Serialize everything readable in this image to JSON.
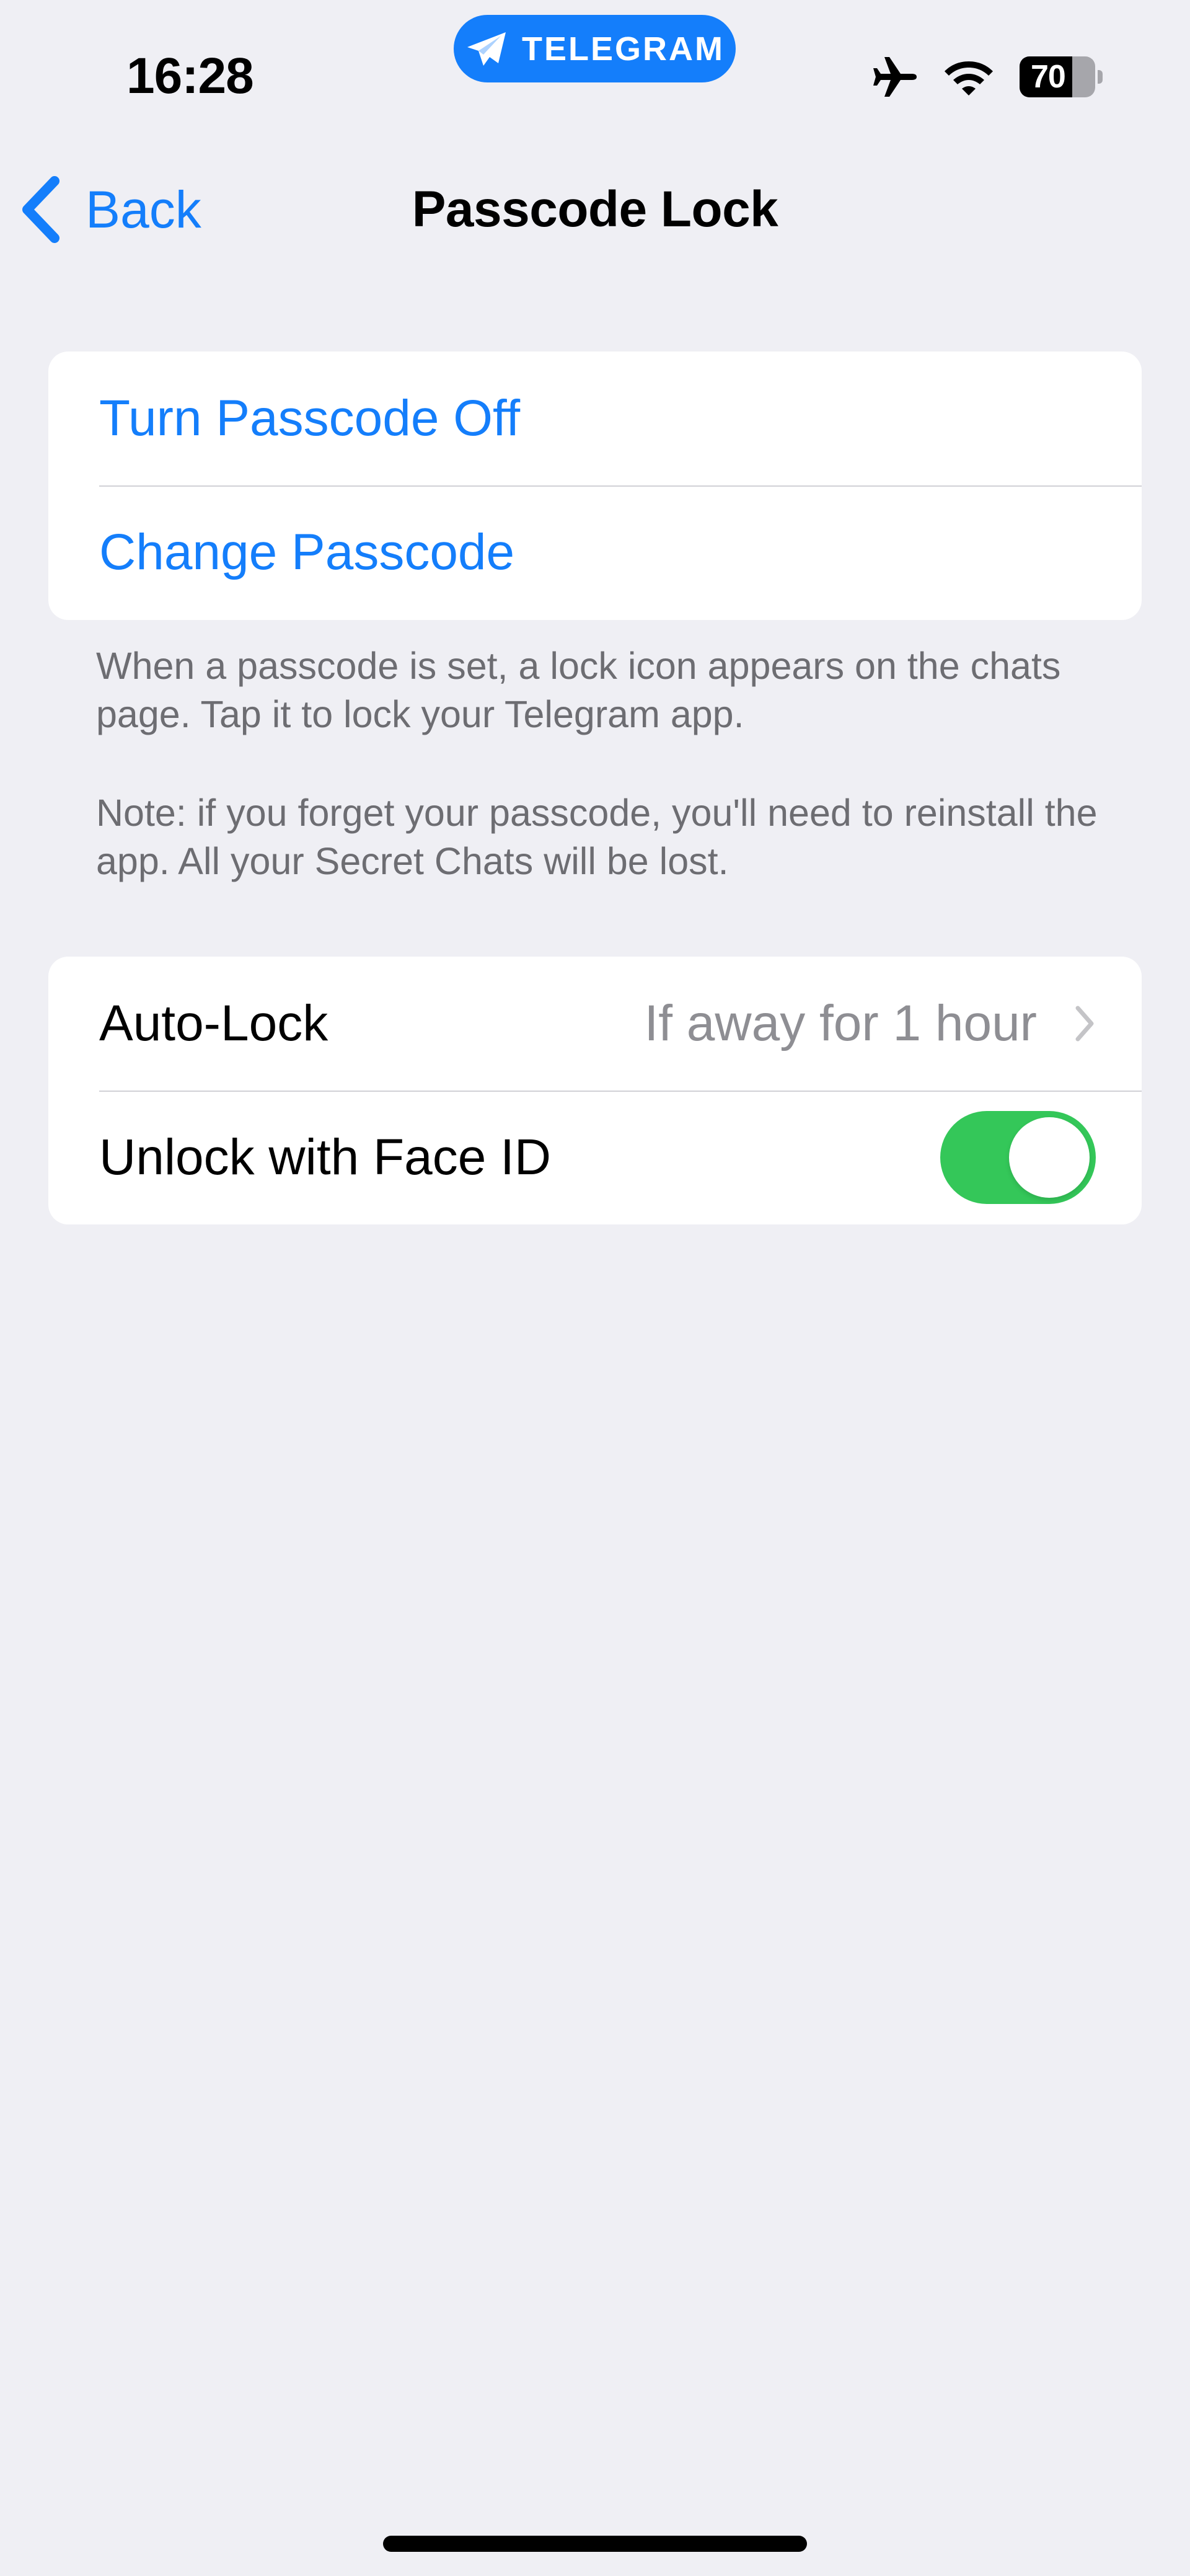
{
  "status_bar": {
    "time": "16:28",
    "app_pill": {
      "label": "TELEGRAM",
      "icon": "telegram-plane-icon",
      "color": "#147EFB"
    },
    "icons": [
      "airplane-mode-icon",
      "wifi-icon",
      "battery-icon"
    ],
    "battery_percent": "70",
    "battery_level": 0.7
  },
  "nav": {
    "back_label": "Back",
    "back_icon": "chevron-left-icon",
    "title": "Passcode Lock"
  },
  "passcode_section": {
    "rows": [
      {
        "label": "Turn Passcode Off"
      },
      {
        "label": "Change Passcode"
      }
    ],
    "footer": [
      "When a passcode is set, a lock icon appears on the chats page. Tap it to lock your Telegram app.",
      "Note: if you forget your passcode, you'll need to reinstall the app. All your Secret Chats will be lost."
    ]
  },
  "lock_section": {
    "auto_lock": {
      "label": "Auto-Lock",
      "value": "If away for 1 hour",
      "icon": "chevron-right-icon"
    },
    "face_id": {
      "label": "Unlock with Face ID",
      "enabled": true
    }
  },
  "colors": {
    "accent": "#147EFB",
    "toggle_on": "#34C759",
    "background": "#EFEFF4",
    "secondary_text": "#6D6D72",
    "value_text": "#8E8E93"
  }
}
